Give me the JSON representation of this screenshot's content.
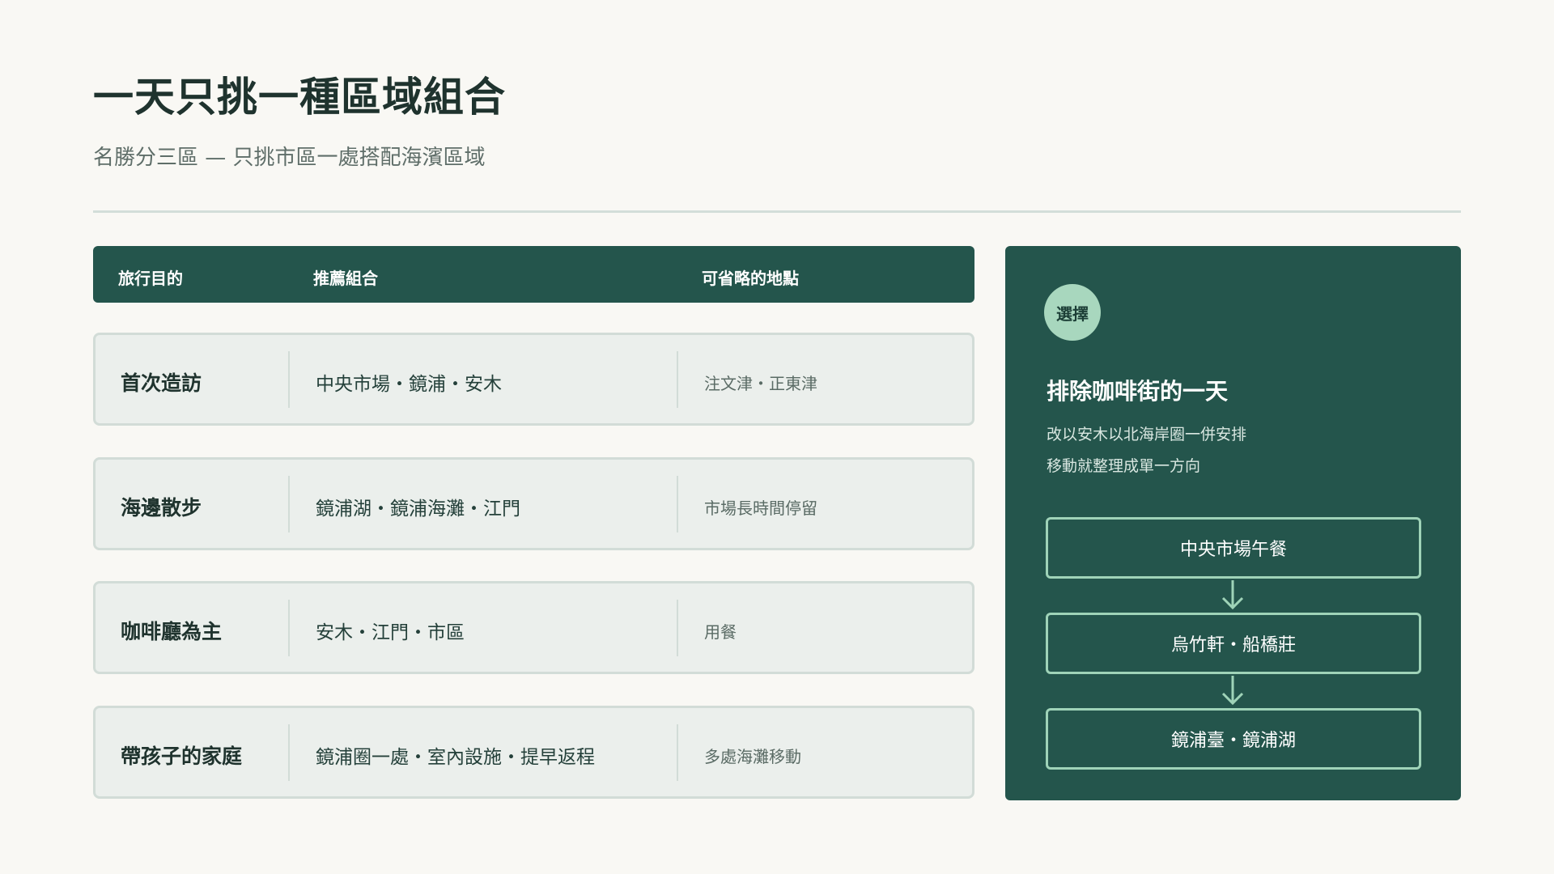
{
  "page": {
    "title": "一天只挑一種區域組合",
    "subtitle": "名勝分三區 — 只挑市區一處搭配海濱區域"
  },
  "table": {
    "headers": [
      "旅行目的",
      "推薦組合",
      "可省略的地點"
    ],
    "rows": [
      {
        "purpose": "首次造訪",
        "combo": "中央市場・鏡浦・安木",
        "skip": "注文津・正東津"
      },
      {
        "purpose": "海邊散步",
        "combo": "鏡浦湖・鏡浦海灘・江門",
        "skip": "市場長時間停留"
      },
      {
        "purpose": "咖啡廳為主",
        "combo": "安木・江門・市區",
        "skip": "用餐"
      },
      {
        "purpose": "帶孩子的家庭",
        "combo": "鏡浦圈一處・室內設施・提早返程",
        "skip": "多處海灘移動"
      }
    ]
  },
  "panel": {
    "badge": "選擇",
    "title": "排除咖啡街的一天",
    "lines": [
      "改以安木以北海岸圈一併安排",
      "移動就整理成單一方向"
    ],
    "flow": [
      "中央市場午餐",
      "烏竹軒・船橋莊",
      "鏡浦臺・鏡浦湖"
    ]
  },
  "colors": {
    "background": "#f9f8f4",
    "primary": "#24554c",
    "accent": "#a8d7be",
    "row_bg": "#ebefec"
  },
  "icons": {
    "flow_arrow": "arrow-down-icon"
  }
}
